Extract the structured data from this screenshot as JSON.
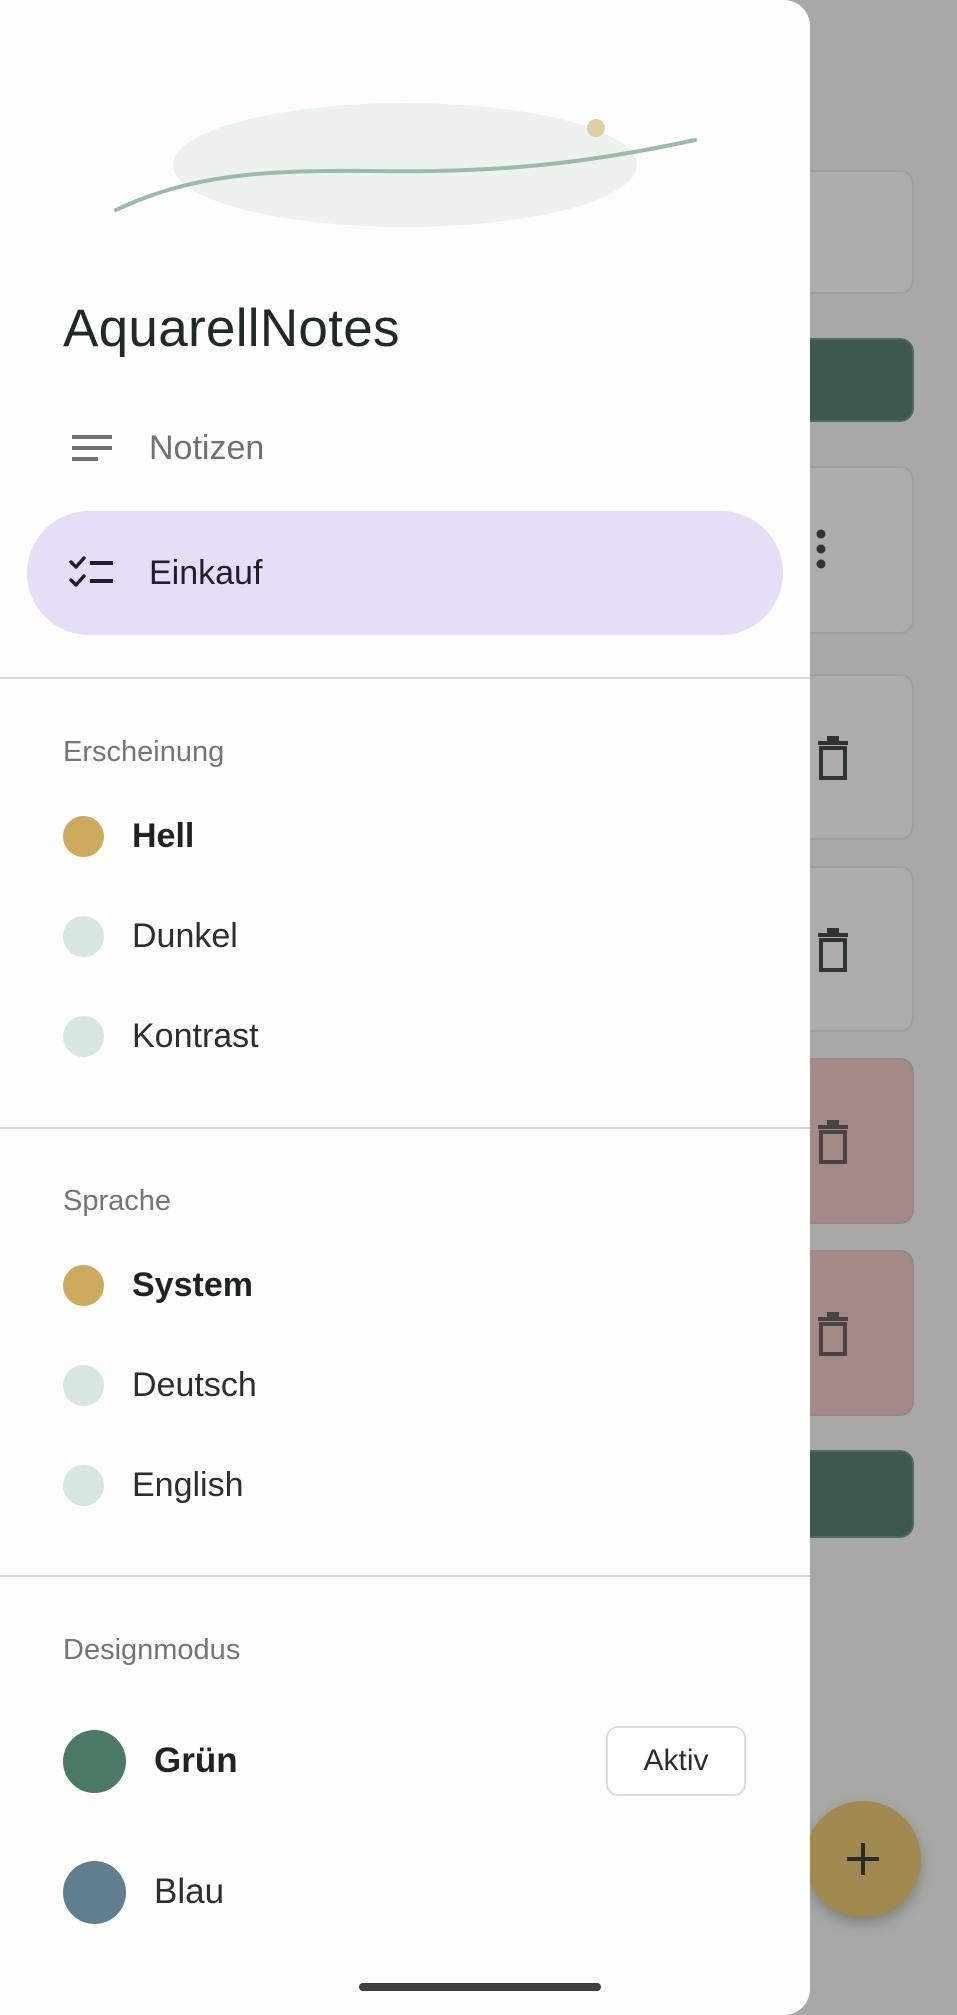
{
  "app": {
    "title": "AquarellNotes"
  },
  "nav": [
    {
      "label": "Notizen",
      "icon": "notes-icon",
      "active": false
    },
    {
      "label": "Einkauf",
      "icon": "checklist-icon",
      "active": true
    }
  ],
  "appearance": {
    "title": "Erscheinung",
    "options": [
      {
        "label": "Hell",
        "selected": true
      },
      {
        "label": "Dunkel",
        "selected": false
      },
      {
        "label": "Kontrast",
        "selected": false
      }
    ]
  },
  "language": {
    "title": "Sprache",
    "options": [
      {
        "label": "System",
        "selected": true
      },
      {
        "label": "Deutsch",
        "selected": false
      },
      {
        "label": "English",
        "selected": false
      }
    ]
  },
  "design": {
    "title": "Designmodus",
    "themes": [
      {
        "label": "Grün",
        "color": "#4a7a64",
        "selected": true,
        "badge": "Aktiv"
      },
      {
        "label": "Blau",
        "color": "#617e91",
        "selected": false
      }
    ]
  },
  "colors": {
    "accent": "#cdaa5e",
    "active_nav_bg": "#e8ddf7",
    "unselected_dot": "#d8e6de"
  },
  "background": {
    "fab_icon": "plus-icon",
    "card_icons": [
      "more-vert-icon",
      "trash-icon"
    ]
  }
}
